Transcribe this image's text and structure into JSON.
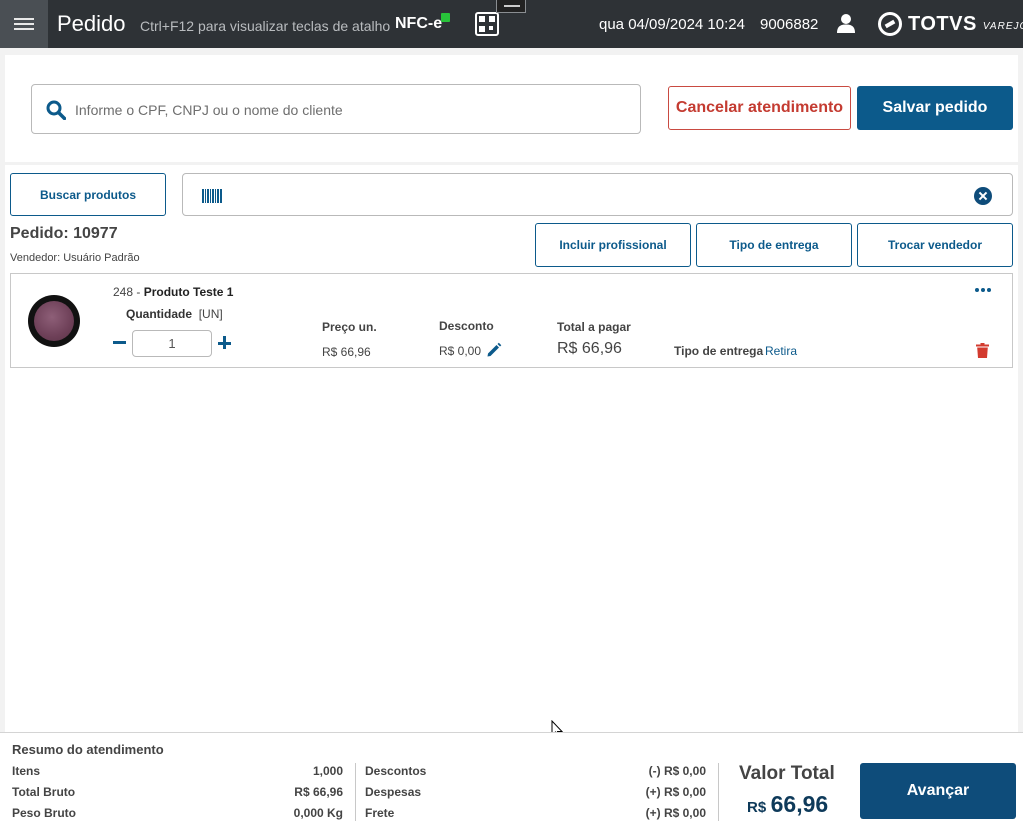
{
  "header": {
    "title": "Pedido",
    "shortcut_hint": "Ctrl+F12 para visualizar teclas de atalho",
    "fiscal_mode": "NFC-e",
    "fiscal_status_color": "#28c33a",
    "datetime": "qua 04/09/2024 10:24",
    "user_code": "9006882",
    "brand_name": "TOTVS",
    "brand_sub": "VAREJO"
  },
  "client": {
    "search_placeholder": "Informe o CPF, CNPJ ou o nome do cliente",
    "search_value": "",
    "cancel_label": "Cancelar atendimento",
    "save_label": "Salvar pedido"
  },
  "products": {
    "search_label": "Buscar produtos",
    "barcode_value": ""
  },
  "order": {
    "title": "Pedido: 10977",
    "seller": "Vendedor: Usuário Padrão",
    "actions": {
      "include_professional": "Incluir profissional",
      "delivery_type": "Tipo de entrega",
      "change_seller": "Trocar vendedor"
    }
  },
  "item": {
    "code": "248 - ",
    "name": "Produto Teste 1",
    "quantity_label": "Quantidade",
    "unit": "[UN]",
    "quantity": "1",
    "unit_price_label": "Preço un.",
    "unit_price": "R$ 66,96",
    "discount_label": "Desconto",
    "discount": "R$ 0,00",
    "total_label": "Total a pagar",
    "total": "R$ 66,96",
    "delivery_label": "Tipo de entrega",
    "delivery_value": "Retira"
  },
  "summary": {
    "title": "Resumo do atendimento",
    "items_label": "Itens",
    "items_value": "1,000",
    "gross_total_label": "Total Bruto",
    "gross_total_value": "R$ 66,96",
    "gross_weight_label": "Peso Bruto",
    "gross_weight_value": "0,000 Kg",
    "discounts_label": "Descontos",
    "discounts_value": "(-) R$ 0,00",
    "expenses_label": "Despesas",
    "expenses_value": "(+) R$ 0,00",
    "freight_label": "Frete",
    "freight_value": "(+) R$ 0,00",
    "total_label": "Valor Total",
    "total_currency": "R$",
    "total_value": "66,96",
    "next_label": "Avançar"
  },
  "colors": {
    "primary": "#0c5a8b",
    "danger": "#c43b31",
    "topbar": "#2e3236"
  }
}
